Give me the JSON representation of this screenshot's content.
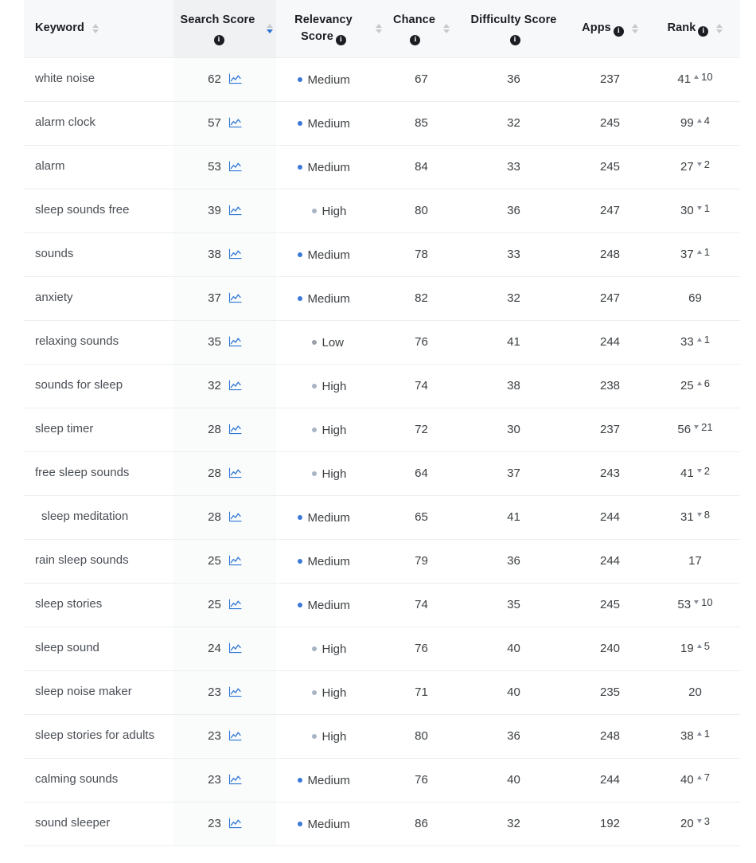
{
  "table": {
    "columns": [
      {
        "key": "keyword",
        "label": "Keyword",
        "has_info": false,
        "sortable": true,
        "sorted": false,
        "align": "left",
        "wrap": false
      },
      {
        "key": "search",
        "label": "Search Score",
        "has_info": true,
        "sortable": true,
        "sorted": true,
        "align": "center",
        "wrap": true
      },
      {
        "key": "relevancy",
        "label": "Relevancy Score",
        "has_info": true,
        "sortable": true,
        "sorted": false,
        "align": "center",
        "wrap": true
      },
      {
        "key": "chance",
        "label": "Chance",
        "has_info": true,
        "sortable": true,
        "sorted": false,
        "align": "center",
        "wrap": true
      },
      {
        "key": "difficulty",
        "label": "Difficulty Score",
        "has_info": true,
        "sortable": true,
        "sorted": false,
        "align": "center",
        "wrap": true
      },
      {
        "key": "apps",
        "label": "Apps",
        "has_info": true,
        "sortable": true,
        "sorted": false,
        "align": "center",
        "wrap": false
      },
      {
        "key": "rank",
        "label": "Rank",
        "has_info": true,
        "sortable": true,
        "sorted": false,
        "align": "center",
        "wrap": false
      }
    ],
    "info_glyph": "i",
    "chart_icon_name": "line-chart-icon",
    "rows": [
      {
        "keyword": "white noise",
        "indent": false,
        "search": 62,
        "relevancy": "Medium",
        "relevancy_level": "medium",
        "chance": 67,
        "difficulty": 36,
        "apps": 237,
        "rank": 41,
        "delta": 10,
        "delta_dir": "up"
      },
      {
        "keyword": "alarm clock",
        "indent": false,
        "search": 57,
        "relevancy": "Medium",
        "relevancy_level": "medium",
        "chance": 85,
        "difficulty": 32,
        "apps": 245,
        "rank": 99,
        "delta": 4,
        "delta_dir": "up"
      },
      {
        "keyword": "alarm",
        "indent": false,
        "search": 53,
        "relevancy": "Medium",
        "relevancy_level": "medium",
        "chance": 84,
        "difficulty": 33,
        "apps": 245,
        "rank": 27,
        "delta": 2,
        "delta_dir": "down"
      },
      {
        "keyword": "sleep sounds free",
        "indent": false,
        "search": 39,
        "relevancy": "High",
        "relevancy_level": "high",
        "chance": 80,
        "difficulty": 36,
        "apps": 247,
        "rank": 30,
        "delta": 1,
        "delta_dir": "down"
      },
      {
        "keyword": "sounds",
        "indent": false,
        "search": 38,
        "relevancy": "Medium",
        "relevancy_level": "medium",
        "chance": 78,
        "difficulty": 33,
        "apps": 248,
        "rank": 37,
        "delta": 1,
        "delta_dir": "up"
      },
      {
        "keyword": "anxiety",
        "indent": false,
        "search": 37,
        "relevancy": "Medium",
        "relevancy_level": "medium",
        "chance": 82,
        "difficulty": 32,
        "apps": 247,
        "rank": 69,
        "delta": null,
        "delta_dir": null
      },
      {
        "keyword": "relaxing sounds",
        "indent": false,
        "search": 35,
        "relevancy": "Low",
        "relevancy_level": "low",
        "chance": 76,
        "difficulty": 41,
        "apps": 244,
        "rank": 33,
        "delta": 1,
        "delta_dir": "up"
      },
      {
        "keyword": "sounds for sleep",
        "indent": false,
        "search": 32,
        "relevancy": "High",
        "relevancy_level": "high",
        "chance": 74,
        "difficulty": 38,
        "apps": 238,
        "rank": 25,
        "delta": 6,
        "delta_dir": "up"
      },
      {
        "keyword": "sleep timer",
        "indent": false,
        "search": 28,
        "relevancy": "High",
        "relevancy_level": "high",
        "chance": 72,
        "difficulty": 30,
        "apps": 237,
        "rank": 56,
        "delta": 21,
        "delta_dir": "down"
      },
      {
        "keyword": "free sleep sounds",
        "indent": false,
        "search": 28,
        "relevancy": "High",
        "relevancy_level": "high",
        "chance": 64,
        "difficulty": 37,
        "apps": 243,
        "rank": 41,
        "delta": 2,
        "delta_dir": "down"
      },
      {
        "keyword": "sleep meditation",
        "indent": true,
        "search": 28,
        "relevancy": "Medium",
        "relevancy_level": "medium",
        "chance": 65,
        "difficulty": 41,
        "apps": 244,
        "rank": 31,
        "delta": 8,
        "delta_dir": "down"
      },
      {
        "keyword": "rain sleep sounds",
        "indent": false,
        "search": 25,
        "relevancy": "Medium",
        "relevancy_level": "medium",
        "chance": 79,
        "difficulty": 36,
        "apps": 244,
        "rank": 17,
        "delta": null,
        "delta_dir": null
      },
      {
        "keyword": "sleep stories",
        "indent": false,
        "search": 25,
        "relevancy": "Medium",
        "relevancy_level": "medium",
        "chance": 74,
        "difficulty": 35,
        "apps": 245,
        "rank": 53,
        "delta": 10,
        "delta_dir": "down"
      },
      {
        "keyword": "sleep sound",
        "indent": false,
        "search": 24,
        "relevancy": "High",
        "relevancy_level": "high",
        "chance": 76,
        "difficulty": 40,
        "apps": 240,
        "rank": 19,
        "delta": 5,
        "delta_dir": "up"
      },
      {
        "keyword": "sleep noise maker",
        "indent": false,
        "search": 23,
        "relevancy": "High",
        "relevancy_level": "high",
        "chance": 71,
        "difficulty": 40,
        "apps": 235,
        "rank": 20,
        "delta": null,
        "delta_dir": null
      },
      {
        "keyword": "sleep stories for adults",
        "indent": false,
        "search": 23,
        "relevancy": "High",
        "relevancy_level": "high",
        "chance": 80,
        "difficulty": 36,
        "apps": 248,
        "rank": 38,
        "delta": 1,
        "delta_dir": "up"
      },
      {
        "keyword": "calming sounds",
        "indent": false,
        "search": 23,
        "relevancy": "Medium",
        "relevancy_level": "medium",
        "chance": 76,
        "difficulty": 40,
        "apps": 244,
        "rank": 40,
        "delta": 7,
        "delta_dir": "up"
      },
      {
        "keyword": "sound sleeper",
        "indent": false,
        "search": 23,
        "relevancy": "Medium",
        "relevancy_level": "medium",
        "chance": 86,
        "difficulty": 32,
        "apps": 192,
        "rank": 20,
        "delta": 3,
        "delta_dir": "down"
      }
    ]
  },
  "colors": {
    "header_bg": "#f7f8f9",
    "active_column_bg": "#f0f1f3",
    "row_border": "#eceef0",
    "text": "#3c4043",
    "heading_text": "#1b1d23",
    "accent_blue": "#2d76d6",
    "dot_medium": "#3b78d8",
    "dot_high": "#a7b4c4",
    "dot_low": "#9aa0a6",
    "arrow_gray": "#8a9099",
    "sorter_gray": "#c6cacd"
  }
}
